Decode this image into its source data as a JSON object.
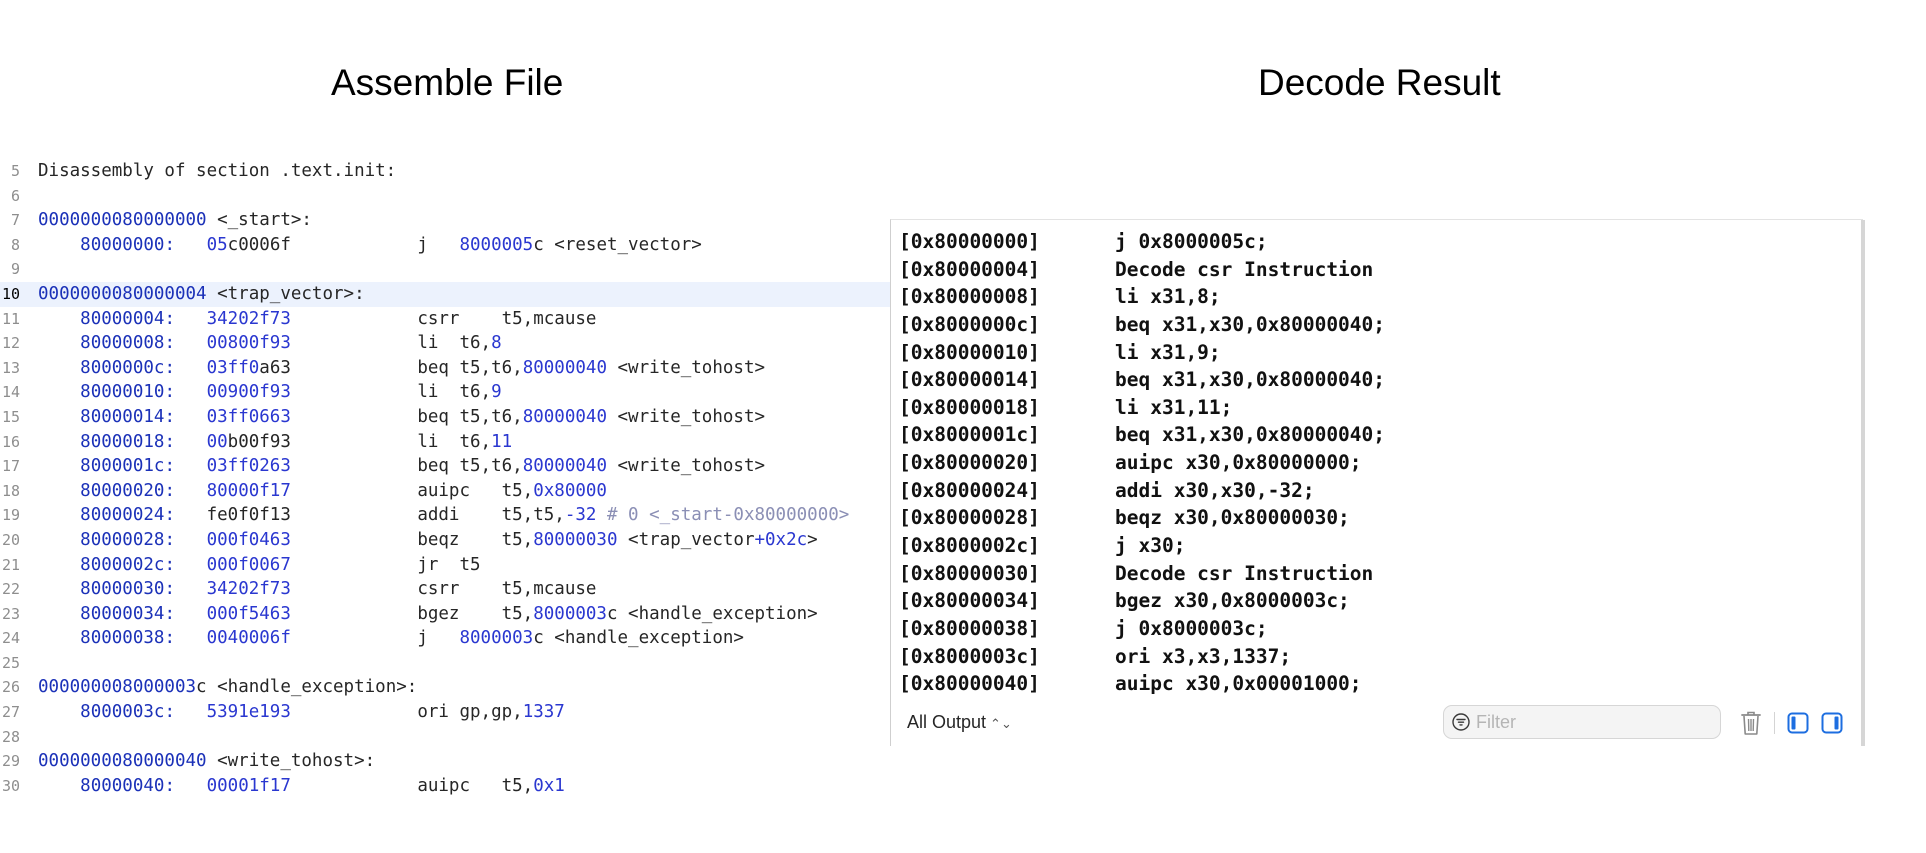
{
  "headings": {
    "left": "Assemble File",
    "right": "Decode Result"
  },
  "code_lines": [
    {
      "no": "5",
      "segments": [
        {
          "t": "Disassembly of section .text.init:",
          "c": "text"
        }
      ]
    },
    {
      "no": "6",
      "segments": []
    },
    {
      "no": "7",
      "segments": [
        {
          "t": "0000000080000000",
          "c": "addr"
        },
        {
          "t": " <_start>:",
          "c": "text"
        }
      ]
    },
    {
      "no": "8",
      "segments": [
        {
          "t": "    ",
          "c": "text"
        },
        {
          "t": "80000000:",
          "c": "addr"
        },
        {
          "t": "   ",
          "c": "text"
        },
        {
          "t": "05",
          "c": "blue"
        },
        {
          "t": "c0006f",
          "c": "text"
        },
        {
          "t": "            j   ",
          "c": "text"
        },
        {
          "t": "8000005",
          "c": "blue"
        },
        {
          "t": "c <reset_vector>",
          "c": "text"
        }
      ]
    },
    {
      "no": "9",
      "segments": []
    },
    {
      "no": "10",
      "highlight": true,
      "segments": [
        {
          "t": "0000000080000004",
          "c": "addr"
        },
        {
          "t": " <trap_vector>:",
          "c": "text"
        }
      ]
    },
    {
      "no": "11",
      "segments": [
        {
          "t": "    ",
          "c": "text"
        },
        {
          "t": "80000004:",
          "c": "addr"
        },
        {
          "t": "   ",
          "c": "text"
        },
        {
          "t": "34202f73",
          "c": "blue"
        },
        {
          "t": "            csrr    t5,mcause",
          "c": "text"
        }
      ]
    },
    {
      "no": "12",
      "segments": [
        {
          "t": "    ",
          "c": "text"
        },
        {
          "t": "80000008:",
          "c": "addr"
        },
        {
          "t": "   ",
          "c": "text"
        },
        {
          "t": "00800f93",
          "c": "blue"
        },
        {
          "t": "            li  t6,",
          "c": "text"
        },
        {
          "t": "8",
          "c": "blue"
        }
      ]
    },
    {
      "no": "13",
      "segments": [
        {
          "t": "    ",
          "c": "text"
        },
        {
          "t": "8000000c:",
          "c": "addr"
        },
        {
          "t": "   ",
          "c": "text"
        },
        {
          "t": "03ff0",
          "c": "blue"
        },
        {
          "t": "a63",
          "c": "text"
        },
        {
          "t": "            beq t5,t6,",
          "c": "text"
        },
        {
          "t": "80000040",
          "c": "blue"
        },
        {
          "t": " <write_tohost>",
          "c": "text"
        }
      ]
    },
    {
      "no": "14",
      "segments": [
        {
          "t": "    ",
          "c": "text"
        },
        {
          "t": "80000010:",
          "c": "addr"
        },
        {
          "t": "   ",
          "c": "text"
        },
        {
          "t": "00900f93",
          "c": "blue"
        },
        {
          "t": "            li  t6,",
          "c": "text"
        },
        {
          "t": "9",
          "c": "blue"
        }
      ]
    },
    {
      "no": "15",
      "segments": [
        {
          "t": "    ",
          "c": "text"
        },
        {
          "t": "80000014:",
          "c": "addr"
        },
        {
          "t": "   ",
          "c": "text"
        },
        {
          "t": "03ff0663",
          "c": "blue"
        },
        {
          "t": "            beq t5,t6,",
          "c": "text"
        },
        {
          "t": "80000040",
          "c": "blue"
        },
        {
          "t": " <write_tohost>",
          "c": "text"
        }
      ]
    },
    {
      "no": "16",
      "segments": [
        {
          "t": "    ",
          "c": "text"
        },
        {
          "t": "80000018:",
          "c": "addr"
        },
        {
          "t": "   ",
          "c": "text"
        },
        {
          "t": "00",
          "c": "blue"
        },
        {
          "t": "b00f93",
          "c": "text"
        },
        {
          "t": "            li  t6,",
          "c": "text"
        },
        {
          "t": "11",
          "c": "blue"
        }
      ]
    },
    {
      "no": "17",
      "segments": [
        {
          "t": "    ",
          "c": "text"
        },
        {
          "t": "8000001c:",
          "c": "addr"
        },
        {
          "t": "   ",
          "c": "text"
        },
        {
          "t": "03ff0263",
          "c": "blue"
        },
        {
          "t": "            beq t5,t6,",
          "c": "text"
        },
        {
          "t": "80000040",
          "c": "blue"
        },
        {
          "t": " <write_tohost>",
          "c": "text"
        }
      ]
    },
    {
      "no": "18",
      "segments": [
        {
          "t": "    ",
          "c": "text"
        },
        {
          "t": "80000020:",
          "c": "addr"
        },
        {
          "t": "   ",
          "c": "text"
        },
        {
          "t": "80000f17",
          "c": "blue"
        },
        {
          "t": "            auipc   t5,",
          "c": "text"
        },
        {
          "t": "0x80000",
          "c": "blue"
        }
      ]
    },
    {
      "no": "19",
      "segments": [
        {
          "t": "    ",
          "c": "text"
        },
        {
          "t": "80000024:",
          "c": "addr"
        },
        {
          "t": "   ",
          "c": "text"
        },
        {
          "t": "fe0f0f13",
          "c": "text"
        },
        {
          "t": "            addi    t5,t5,",
          "c": "text"
        },
        {
          "t": "-32",
          "c": "blue"
        },
        {
          "t": " # 0 <_start-0x80000000>",
          "c": "grey"
        }
      ]
    },
    {
      "no": "20",
      "segments": [
        {
          "t": "    ",
          "c": "text"
        },
        {
          "t": "80000028:",
          "c": "addr"
        },
        {
          "t": "   ",
          "c": "text"
        },
        {
          "t": "000f0463",
          "c": "blue"
        },
        {
          "t": "            beqz    t5,",
          "c": "text"
        },
        {
          "t": "80000030",
          "c": "blue"
        },
        {
          "t": " <trap_vector",
          "c": "text"
        },
        {
          "t": "+0x2c",
          "c": "blue"
        },
        {
          "t": ">",
          "c": "text"
        }
      ]
    },
    {
      "no": "21",
      "segments": [
        {
          "t": "    ",
          "c": "text"
        },
        {
          "t": "8000002c:",
          "c": "addr"
        },
        {
          "t": "   ",
          "c": "text"
        },
        {
          "t": "000f0067",
          "c": "blue"
        },
        {
          "t": "            jr  t5",
          "c": "text"
        }
      ]
    },
    {
      "no": "22",
      "segments": [
        {
          "t": "    ",
          "c": "text"
        },
        {
          "t": "80000030:",
          "c": "addr"
        },
        {
          "t": "   ",
          "c": "text"
        },
        {
          "t": "34202f73",
          "c": "blue"
        },
        {
          "t": "            csrr    t5,mcause",
          "c": "text"
        }
      ]
    },
    {
      "no": "23",
      "segments": [
        {
          "t": "    ",
          "c": "text"
        },
        {
          "t": "80000034:",
          "c": "addr"
        },
        {
          "t": "   ",
          "c": "text"
        },
        {
          "t": "000f5463",
          "c": "blue"
        },
        {
          "t": "            bgez    t5,",
          "c": "text"
        },
        {
          "t": "8000003",
          "c": "blue"
        },
        {
          "t": "c <handle_exception>",
          "c": "text"
        }
      ]
    },
    {
      "no": "24",
      "segments": [
        {
          "t": "    ",
          "c": "text"
        },
        {
          "t": "80000038:",
          "c": "addr"
        },
        {
          "t": "   ",
          "c": "text"
        },
        {
          "t": "0040006f",
          "c": "blue"
        },
        {
          "t": "            j   ",
          "c": "text"
        },
        {
          "t": "8000003",
          "c": "blue"
        },
        {
          "t": "c <handle_exception>",
          "c": "text"
        }
      ]
    },
    {
      "no": "25",
      "segments": []
    },
    {
      "no": "26",
      "segments": [
        {
          "t": "000000008000003",
          "c": "addr"
        },
        {
          "t": "c <handle_exception>:",
          "c": "text"
        }
      ]
    },
    {
      "no": "27",
      "segments": [
        {
          "t": "    ",
          "c": "text"
        },
        {
          "t": "8000003c:",
          "c": "addr"
        },
        {
          "t": "   ",
          "c": "text"
        },
        {
          "t": "5391e193",
          "c": "blue"
        },
        {
          "t": "            ori gp,gp,",
          "c": "text"
        },
        {
          "t": "1337",
          "c": "blue"
        }
      ]
    },
    {
      "no": "28",
      "segments": []
    },
    {
      "no": "29",
      "segments": [
        {
          "t": "0000000080000040",
          "c": "addr"
        },
        {
          "t": " <write_tohost>:",
          "c": "text"
        }
      ]
    },
    {
      "no": "30",
      "segments": [
        {
          "t": "    ",
          "c": "text"
        },
        {
          "t": "80000040:",
          "c": "addr"
        },
        {
          "t": "   ",
          "c": "text"
        },
        {
          "t": "00001f17",
          "c": "blue"
        },
        {
          "t": "            auipc   t5,",
          "c": "text"
        },
        {
          "t": "0x1",
          "c": "blue"
        }
      ]
    }
  ],
  "output": {
    "lines": [
      {
        "addr": "[0x80000000]",
        "instr": "j 0x8000005c;"
      },
      {
        "addr": "[0x80000004]",
        "instr": "Decode csr Instruction"
      },
      {
        "addr": "[0x80000008]",
        "instr": "li x31,8;"
      },
      {
        "addr": "[0x8000000c]",
        "instr": "beq x31,x30,0x80000040;"
      },
      {
        "addr": "[0x80000010]",
        "instr": "li x31,9;"
      },
      {
        "addr": "[0x80000014]",
        "instr": "beq x31,x30,0x80000040;"
      },
      {
        "addr": "[0x80000018]",
        "instr": "li x31,11;"
      },
      {
        "addr": "[0x8000001c]",
        "instr": "beq x31,x30,0x80000040;"
      },
      {
        "addr": "[0x80000020]",
        "instr": "auipc x30,0x80000000;"
      },
      {
        "addr": "[0x80000024]",
        "instr": "addi x30,x30,-32;"
      },
      {
        "addr": "[0x80000028]",
        "instr": "beqz x30,0x80000030;"
      },
      {
        "addr": "[0x8000002c]",
        "instr": "j x30;"
      },
      {
        "addr": "[0x80000030]",
        "instr": "Decode csr Instruction"
      },
      {
        "addr": "[0x80000034]",
        "instr": "bgez x30,0x8000003c;"
      },
      {
        "addr": "[0x80000038]",
        "instr": "j 0x8000003c;"
      },
      {
        "addr": "[0x8000003c]",
        "instr": "ori x3,x3,1337;"
      },
      {
        "addr": "[0x80000040]",
        "instr": "auipc x30,0x00001000;"
      }
    ],
    "toolbar": {
      "mode_label": "All Output",
      "filter_placeholder": "Filter"
    }
  },
  "icons": {
    "filter": "filter-icon",
    "trash": "trash-icon",
    "left_pane": "sidebar-left-icon",
    "right_pane": "sidebar-right-icon",
    "mode_chevron": "chevron-up-down-icon"
  },
  "colors": {
    "address": "#1b31b8",
    "literal": "#2a37d0",
    "comment": "#8b8fb5",
    "highlight_line": "#ecf2fd",
    "accent": "#1d6ee0"
  }
}
